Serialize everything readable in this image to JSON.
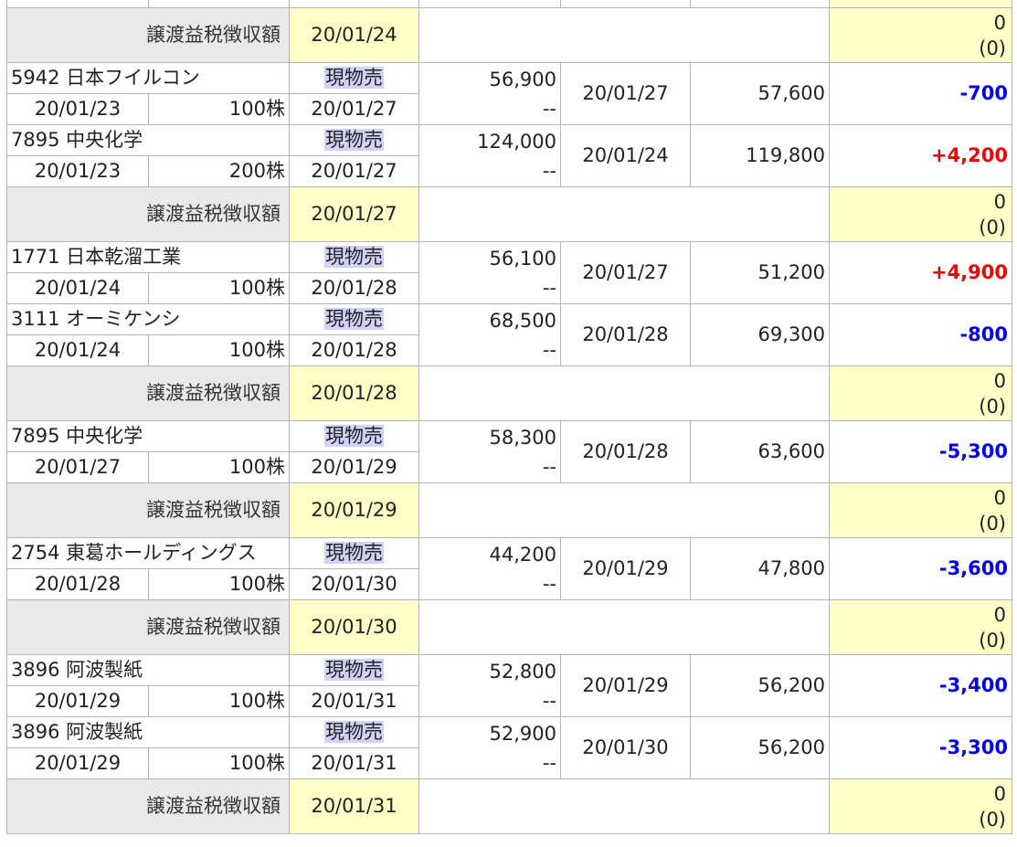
{
  "tax_label": "譲渡益税徴収額",
  "kind_label": "現物売",
  "rows": [
    {
      "type": "tax",
      "date": "20/01/24",
      "amount": "0",
      "sub": "(0)"
    },
    {
      "type": "trade",
      "code_name": "5942 日本フイルコン",
      "buy_date": "20/01/23",
      "qty": "100株",
      "settle": "20/01/27",
      "buy_price": "56,900",
      "fee": "--",
      "sell_date": "20/01/27",
      "sell_price": "57,600",
      "pl": "-700",
      "pl_sign": "neg"
    },
    {
      "type": "trade",
      "code_name": "7895 中央化学",
      "buy_date": "20/01/23",
      "qty": "200株",
      "settle": "20/01/27",
      "buy_price": "124,000",
      "fee": "--",
      "sell_date": "20/01/24",
      "sell_price": "119,800",
      "pl": "+4,200",
      "pl_sign": "pos"
    },
    {
      "type": "tax",
      "date": "20/01/27",
      "amount": "0",
      "sub": "(0)"
    },
    {
      "type": "trade",
      "code_name": "1771 日本乾溜工業",
      "buy_date": "20/01/24",
      "qty": "100株",
      "settle": "20/01/28",
      "buy_price": "56,100",
      "fee": "--",
      "sell_date": "20/01/27",
      "sell_price": "51,200",
      "pl": "+4,900",
      "pl_sign": "pos"
    },
    {
      "type": "trade",
      "code_name": "3111 オーミケンシ",
      "buy_date": "20/01/24",
      "qty": "100株",
      "settle": "20/01/28",
      "buy_price": "68,500",
      "fee": "--",
      "sell_date": "20/01/28",
      "sell_price": "69,300",
      "pl": "-800",
      "pl_sign": "neg"
    },
    {
      "type": "tax",
      "date": "20/01/28",
      "amount": "0",
      "sub": "(0)"
    },
    {
      "type": "trade",
      "code_name": "7895 中央化学",
      "buy_date": "20/01/27",
      "qty": "100株",
      "settle": "20/01/29",
      "buy_price": "58,300",
      "fee": "--",
      "sell_date": "20/01/28",
      "sell_price": "63,600",
      "pl": "-5,300",
      "pl_sign": "neg"
    },
    {
      "type": "tax",
      "date": "20/01/29",
      "amount": "0",
      "sub": "(0)"
    },
    {
      "type": "trade",
      "code_name": "2754 東葛ホールディングス",
      "buy_date": "20/01/28",
      "qty": "100株",
      "settle": "20/01/30",
      "buy_price": "44,200",
      "fee": "--",
      "sell_date": "20/01/29",
      "sell_price": "47,800",
      "pl": "-3,600",
      "pl_sign": "neg"
    },
    {
      "type": "tax",
      "date": "20/01/30",
      "amount": "0",
      "sub": "(0)"
    },
    {
      "type": "trade",
      "code_name": "3896 阿波製紙",
      "buy_date": "20/01/29",
      "qty": "100株",
      "settle": "20/01/31",
      "buy_price": "52,800",
      "fee": "--",
      "sell_date": "20/01/29",
      "sell_price": "56,200",
      "pl": "-3,400",
      "pl_sign": "neg"
    },
    {
      "type": "trade",
      "code_name": "3896 阿波製紙",
      "buy_date": "20/01/29",
      "qty": "100株",
      "settle": "20/01/31",
      "buy_price": "52,900",
      "fee": "--",
      "sell_date": "20/01/30",
      "sell_price": "56,200",
      "pl": "-3,300",
      "pl_sign": "neg"
    },
    {
      "type": "tax",
      "date": "20/01/31",
      "amount": "0",
      "sub": "(0)"
    }
  ],
  "colors": {
    "negative": "#0000ee",
    "positive": "#ee0000",
    "tax_label_bg": "#e9e9e9",
    "highlight_bg": "#ffffc8",
    "kind_bg": "#d2d2f8"
  }
}
